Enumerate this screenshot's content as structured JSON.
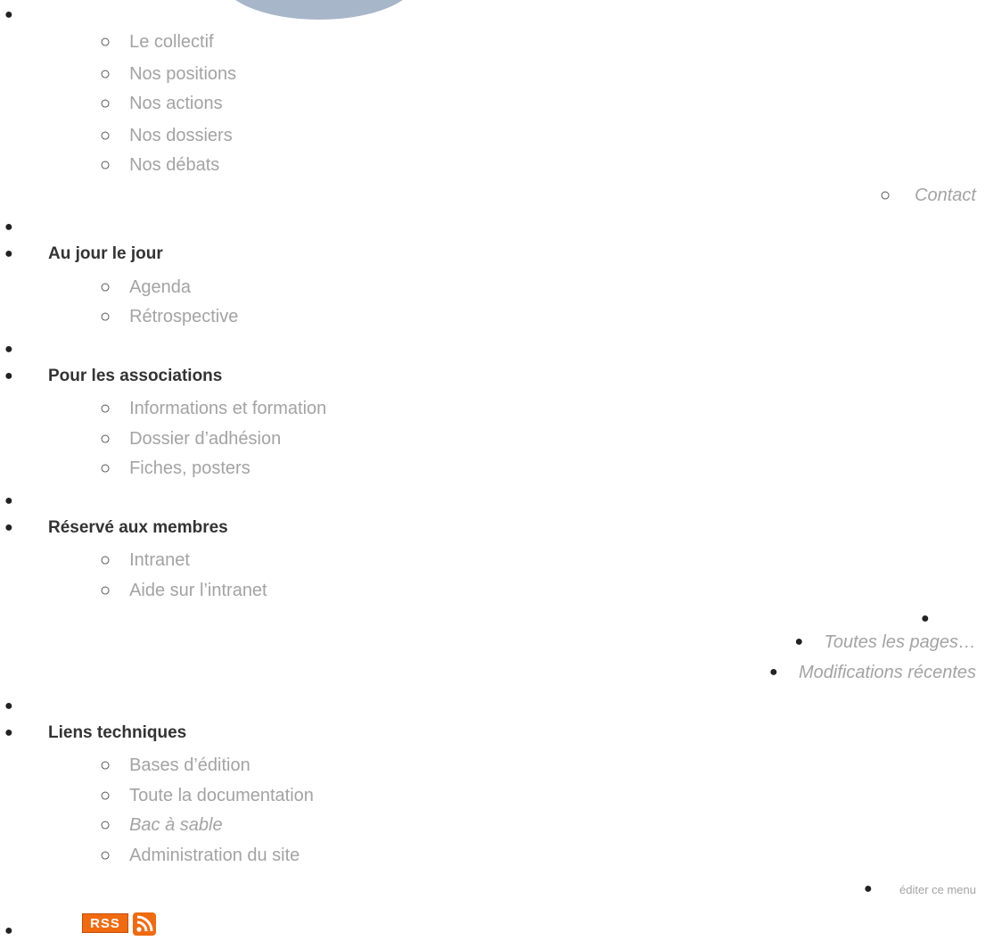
{
  "nav": {
    "collectif_items": [
      "Le collectif",
      "Nos positions",
      "Nos actions",
      "Nos dossiers",
      "Nos débats"
    ],
    "contact": "Contact",
    "au_jour": {
      "heading": "Au jour le jour",
      "items": [
        "Agenda",
        "Rétrospective"
      ]
    },
    "associations": {
      "heading": "Pour les associations",
      "items": [
        "Informations et formation",
        "Dossier d’adhésion",
        "Fiches, posters"
      ]
    },
    "membres": {
      "heading": "Réservé aux membres",
      "items": [
        "Intranet",
        "Aide sur l’intranet"
      ]
    },
    "toutes_pages": "Toutes les pages…",
    "modifications": "Modifications récentes",
    "techniques": {
      "heading": "Liens techniques",
      "items": [
        "Bases d’édition",
        "Toute la documentation",
        "Bac à sable",
        "Administration du site"
      ]
    },
    "editer_menu": "éditer ce menu"
  },
  "rss": {
    "badge_label": "RSS"
  },
  "icons": {
    "logo": "site-logo",
    "feed": "rss-feed-icon"
  },
  "colors": {
    "link": "#a3a3a3",
    "rss_orange": "#f26a10"
  }
}
